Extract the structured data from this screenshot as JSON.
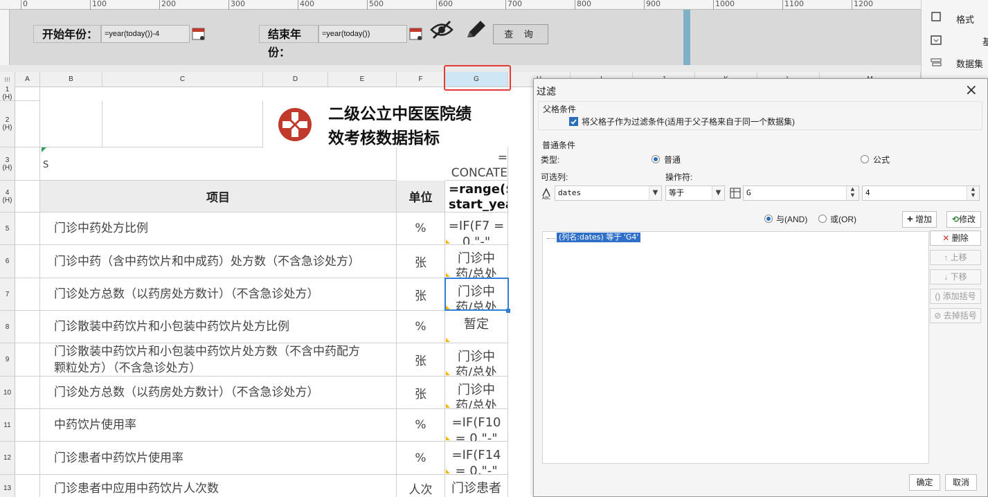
{
  "ruler": {
    "ticks": [
      "0",
      "100",
      "200",
      "300",
      "400",
      "500",
      "600",
      "700",
      "800",
      "900",
      "1000",
      "1100",
      "1200"
    ]
  },
  "params": {
    "start_label": "开始年份：",
    "start_value": "=year(today())-4",
    "end_label": "结束年份：",
    "end_value": "=year(today())",
    "query_label": "查 询"
  },
  "right_panel": {
    "format": "格式",
    "basic": "基",
    "dataset": "数据集"
  },
  "columns": [
    "A",
    "B",
    "C",
    "D",
    "E",
    "F",
    "G",
    "H",
    "I",
    "J",
    "K",
    "L",
    "M"
  ],
  "rows": [
    {
      "label": "1 (H)"
    },
    {
      "label": "2 (H)"
    },
    {
      "label": "3 (H)"
    },
    {
      "label": "4 (H)"
    },
    {
      "label": "5"
    },
    {
      "label": "6"
    },
    {
      "label": "7"
    },
    {
      "label": "8"
    },
    {
      "label": "9"
    },
    {
      "label": "10"
    },
    {
      "label": "11"
    },
    {
      "label": "12"
    },
    {
      "label": "13"
    }
  ],
  "report": {
    "title_line1": "二级公立中医医院绩",
    "title_line2": "效考核数据指标",
    "s_cell": "S",
    "g3": "=\nCONCATE",
    "header_item": "项目",
    "header_unit": "单位",
    "g4": "=range($\nstart_yea",
    "items": [
      {
        "item": "门诊中药处方比例",
        "unit": "%",
        "g": "=IF(F7 =\n0,\"-\""
      },
      {
        "item": "门诊中药（含中药饮片和中成药）处方数（不含急诊处方）",
        "unit": "张",
        "g": "门诊中\n药/总处"
      },
      {
        "item": "门诊处方总数（以药房处方数计）（不含急诊处方）",
        "unit": "张",
        "g": "门诊中\n药/总处"
      },
      {
        "item": "门诊散装中药饮片和小包装中药饮片处方比例",
        "unit": "%",
        "g": "暂定"
      },
      {
        "item": "门诊散装中药饮片和小包装中药饮片处方数（不含中药配方\n颗粒处方）（不含急诊处方）",
        "unit": "张",
        "g": "门诊中\n药/总处"
      },
      {
        "item": "门诊处方总数（以药房处方数计）（不含急诊处方）",
        "unit": "张",
        "g": "门诊中\n药/总处"
      },
      {
        "item": "中药饮片使用率",
        "unit": "%",
        "g": "=IF(F10\n= 0,\"-\""
      },
      {
        "item": "门诊患者中药饮片使用率",
        "unit": "%",
        "g": "=IF(F14\n= 0,\"-\""
      },
      {
        "item": "门诊患者中应用中药饮片人次数",
        "unit": "人次",
        "g": "门诊患者"
      }
    ]
  },
  "dialog": {
    "title": "过滤",
    "parent_section": "父格条件",
    "parent_checkbox": "将父格子作为过滤条件(适用于父子格来自于同一个数据集)",
    "normal_section": "普通条件",
    "type_label": "类型:",
    "type_normal": "普通",
    "type_formula": "公式",
    "columns_label": "可选列:",
    "operator_label": "操作符:",
    "column_value": "dates",
    "operator_value": "等于",
    "value1": "G",
    "value2": "4",
    "and_label": "与(AND)",
    "or_label": "或(OR)",
    "add_button": "增加",
    "modify_button": "修改",
    "condition": "(列名:dates) 等于 'G4'",
    "delete_button": "删除",
    "up_button": "上移",
    "down_button": "下移",
    "add_bracket": "添加括号",
    "remove_bracket": "去掉括号",
    "ok_button": "确定",
    "cancel_button": "取消"
  },
  "colors": {
    "highlight": "#e53935",
    "selection": "#2f7fd8",
    "condition_bg": "#3070c8"
  }
}
